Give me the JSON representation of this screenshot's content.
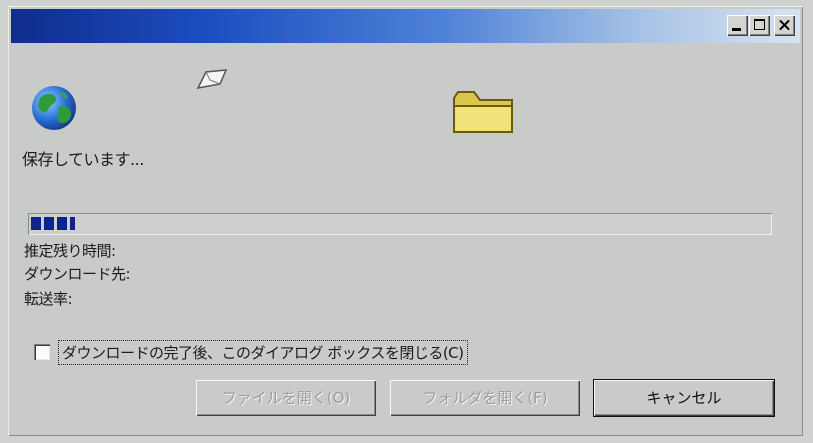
{
  "dialog": {
    "status_text": "保存しています...",
    "progress": {
      "fraction": 0.06,
      "color": "#0f248a"
    }
  },
  "info": {
    "eta_label": "推定残り時間:",
    "destination_label": "ダウンロード先:",
    "transfer_rate_label": "転送率:"
  },
  "options": {
    "close_when_done_label": "ダウンロードの完了後、このダイアログ ボックスを閉じる(C)",
    "close_when_done_checked": false
  },
  "buttons": {
    "open_file": "ファイルを開く(O)",
    "open_folder": "フォルダを開く(F)",
    "cancel": "キャンセル"
  },
  "icons": {
    "globe": "globe-icon",
    "paper": "flying-document-icon",
    "folder": "folder-icon"
  },
  "colors": {
    "titlebar_start": "#0f2d8c",
    "titlebar_end": "#d7e3f0",
    "window_face": "#c9cbc8"
  }
}
